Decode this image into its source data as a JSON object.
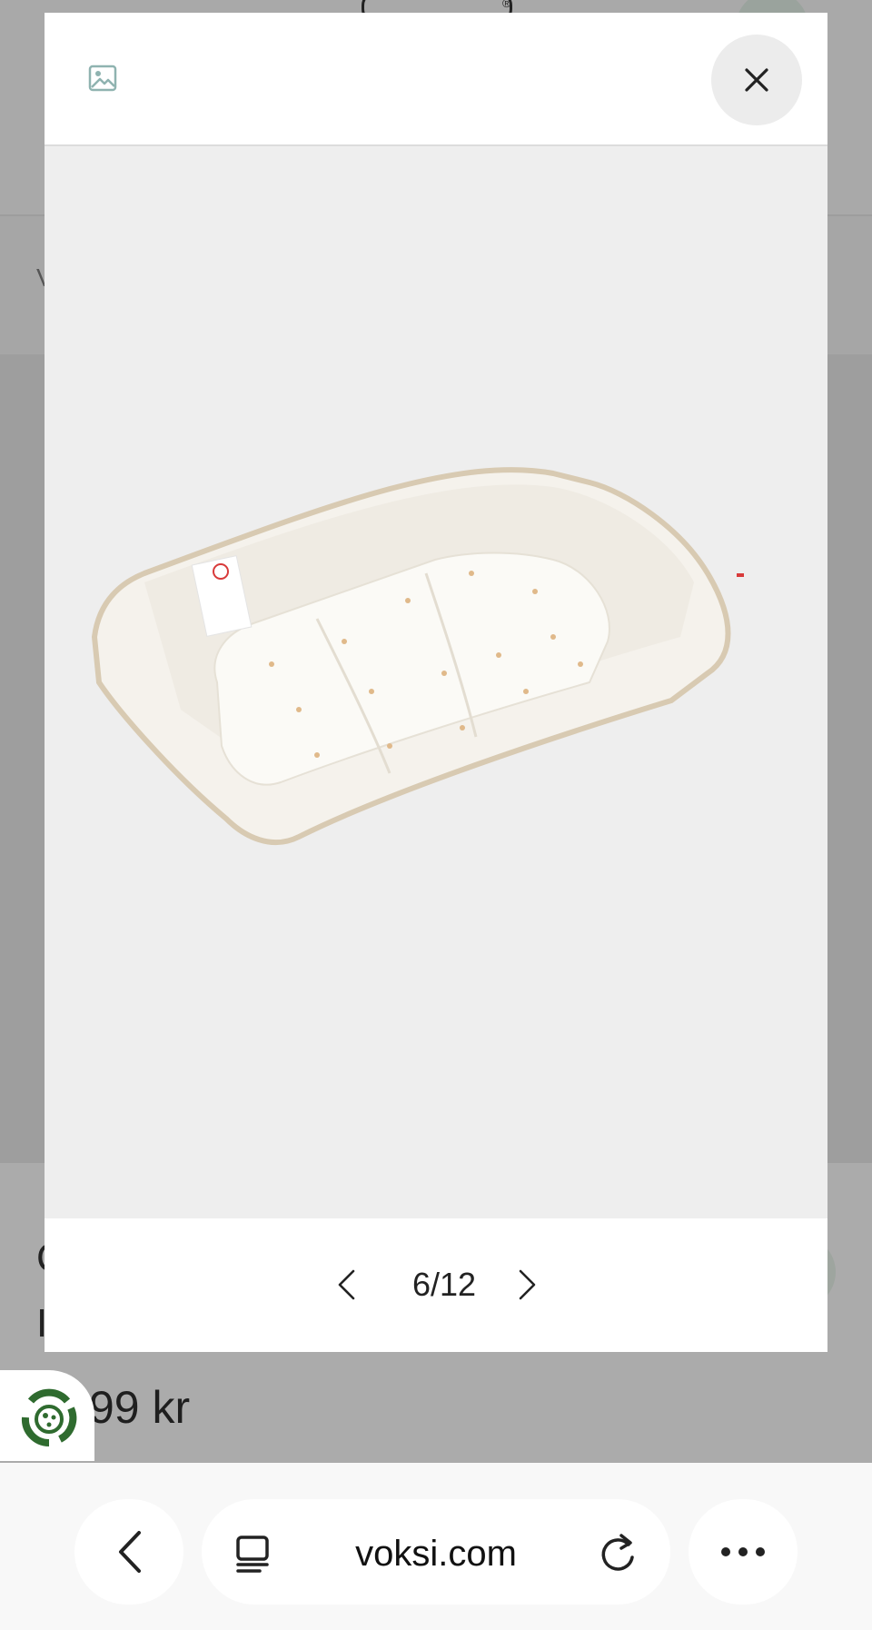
{
  "background": {
    "price_text": "99 kr",
    "side_letter_1": "V",
    "side_letter_2": "C",
    "side_letter_3": "I"
  },
  "modal": {
    "header_icon": "image-icon",
    "close_icon": "close-icon",
    "product_image_alt": "Beige baby nest mattress with printed insert",
    "pager": {
      "current": 6,
      "total": 12,
      "label": "6/12",
      "prev_icon": "chevron-left-icon",
      "next_icon": "chevron-right-icon"
    }
  },
  "browser": {
    "back_icon": "chevron-left-icon",
    "tabs_icon": "tabs-icon",
    "url": "voksi.com",
    "reload_icon": "reload-icon",
    "more_icon": "more-icon"
  },
  "colors": {
    "overlay": "#ababab",
    "modal_bg": "#ffffff",
    "image_bg": "#eeeeee",
    "eco_green": "#2f6b2f"
  }
}
